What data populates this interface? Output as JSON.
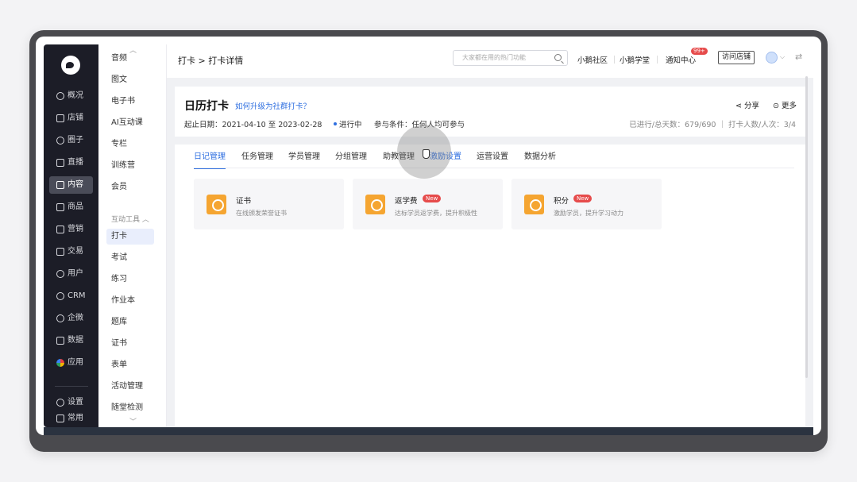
{
  "nav": {
    "items": [
      {
        "label": "概况",
        "icon": "chart-pie-icon"
      },
      {
        "label": "店铺",
        "icon": "store-icon"
      },
      {
        "label": "圈子",
        "icon": "community-icon"
      },
      {
        "label": "直播",
        "icon": "live-icon"
      },
      {
        "label": "内容",
        "icon": "content-icon"
      },
      {
        "label": "商品",
        "icon": "goods-icon"
      },
      {
        "label": "营销",
        "icon": "megaphone-icon"
      },
      {
        "label": "交易",
        "icon": "trade-icon"
      },
      {
        "label": "用户",
        "icon": "user-icon"
      },
      {
        "label": "CRM",
        "icon": "crm-icon"
      },
      {
        "label": "企微",
        "icon": "wecom-icon"
      },
      {
        "label": "数据",
        "icon": "data-icon"
      },
      {
        "label": "应用",
        "icon": "apps-icon"
      },
      {
        "label": "设置",
        "icon": "gear-icon"
      },
      {
        "label": "常用",
        "icon": "list-icon"
      }
    ],
    "active": "内容"
  },
  "subnav": {
    "items_top": [
      "音频",
      "图文",
      "电子书",
      "AI互动课",
      "专栏",
      "训练营",
      "会员"
    ],
    "group_label": "互动工具",
    "items_tools": [
      "打卡",
      "考试",
      "练习",
      "作业本",
      "题库",
      "证书",
      "表单",
      "活动管理",
      "随堂检测"
    ],
    "active": "打卡"
  },
  "topbar": {
    "breadcrumb": "打卡 > 打卡详情",
    "search_placeholder": "大家都在用的热门功能",
    "links": [
      "小鹅社区",
      "小鹅学堂",
      "通知中心"
    ],
    "notify_badge": "99+",
    "visit_store": "访问店铺"
  },
  "header": {
    "title": "日历打卡",
    "upgrade_link": "如何升级为社群打卡？",
    "date_range": "起止日期：2021-04-10 至 2023-02-28",
    "status": "进行中",
    "condition": "参与条件：任何人均可参与",
    "share": "分享",
    "more": "更多",
    "stats": "已进行/总天数：679/690 ｜ 打卡人数/人次：3/4"
  },
  "tabs": [
    {
      "label": "日记管理",
      "active": true
    },
    {
      "label": "任务管理",
      "active": false
    },
    {
      "label": "学员管理",
      "active": false
    },
    {
      "label": "分组管理",
      "active": false
    },
    {
      "label": "助教管理",
      "active": false
    },
    {
      "label": "激励设置",
      "active": false
    },
    {
      "label": "运营设置",
      "active": false
    },
    {
      "label": "数据分析",
      "active": false
    }
  ],
  "features": [
    {
      "title": "证书",
      "desc": "在线颁发荣誉证书",
      "badge": ""
    },
    {
      "title": "返学费",
      "desc": "达标学员返学费，提升积极性",
      "badge": "New"
    },
    {
      "title": "积分",
      "desc": "激励学员，提升学习动力",
      "badge": "New"
    }
  ],
  "colors": {
    "accent": "#2f6fe0",
    "orange": "#f5a531",
    "badge_red": "#e64b4b",
    "nav_bg": "#1c1d27"
  }
}
